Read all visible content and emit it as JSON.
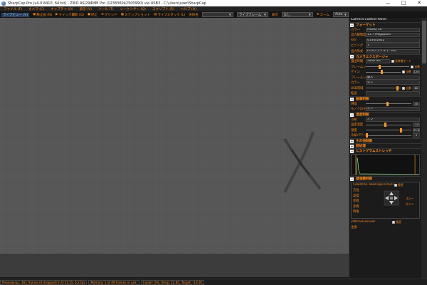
{
  "titlebar": {
    "title": "SharpCap Pro (v4.0.8410, 64 bit) - ZWO ASI294MM Pro (123836042500990) via USB3 - C:\\Users\\user\\SharpCap",
    "minimize": "—",
    "maximize": "□",
    "close": "✕"
  },
  "menu": [
    "ファイル (F)",
    "カメラ (C)",
    "キャプチャ (O)",
    "表示 (V)",
    "ツール (T)",
    "シーケンサー (Q)",
    "スクリプト (S)",
    "ヘルプ (H)"
  ],
  "toolbar": {
    "live": "ライブビュー (V)",
    "still": "静止画 (N)",
    "quick": "クイック撮影 (Q)",
    "stop": "停止",
    "grid": "グリッド",
    "snapshot": "スナップショット",
    "livestack": "ライブスタック (L)",
    "stack_after": "天体名",
    "frame_label": "ライブフレーム",
    "zoom_label": "ズーム",
    "display_value": "なし",
    "zoom_value": "Auto"
  },
  "status": [
    "Previewing : 161 frames (0 dropped) in 0:11:15, 0.2 fps",
    "Memory: 1 of 49 frames in use.",
    "Cooler: 0%, Temp: 22.6C, Target: -10.0C"
  ],
  "panel": {
    "title": "Camera Control Panel",
    "sections": {
      "format": "フォーマット",
      "exposure": "カメラエクスポージャ",
      "display": "画像制御",
      "cooling": "温度制御",
      "misc": "その他制御",
      "preprocess": "前処理",
      "histogram": "ヒストグラムストレッチ",
      "telescope": "望遠鏡制御"
    },
    "format_rows": [
      {
        "label": "カラー",
        "value": "MONO 16"
      },
      {
        "label": "出力解像度モード",
        "value": "11.7 Megapixel"
      },
      {
        "label": "ROI",
        "value": "4144x2822"
      },
      {
        "label": "ビニング",
        "value": "1"
      },
      {
        "label": "出力形式",
        "value": "FITSファイル (*.fits)"
      }
    ],
    "exposure": {
      "time_label": "露出時間",
      "time_value": "5000 ms",
      "longexp": "長時間モード",
      "frame_label": "フレームレート",
      "speed_label": "転送",
      "gain_label": "ゲイン",
      "gain_value": "120",
      "offset_label": "フレームレート",
      "offset_value": "最大",
      "color_label": "カラー",
      "color_value": "なし",
      "bw_label": "USB帯域",
      "bw_value": "80",
      "auto": "自動",
      "autoexp": "自動"
    },
    "display_rows": [
      {
        "label": "明暗",
        "value": "40"
      },
      {
        "label": "モノクロモード",
        "value": "オフ"
      }
    ],
    "cooling_rows": [
      {
        "label": "冷却",
        "value": "オン"
      },
      {
        "label": "設定温度",
        "value": "-10"
      },
      {
        "label": "温度",
        "value": "22.6"
      },
      {
        "label": "冷却パワー",
        "value": "0"
      }
    ],
    "telescope": {
      "driver": "Celestron Telescope Driver",
      "connect": "接続",
      "ra": "方位",
      "dec": "高度",
      "alt": "赤経",
      "az": "赤緯",
      "pier": "時角",
      "slew": "スルー",
      "guide": "ガイド",
      "focuser": "ZWO EAFocuser",
      "focus_connect": "接続"
    },
    "footer": "注意"
  }
}
